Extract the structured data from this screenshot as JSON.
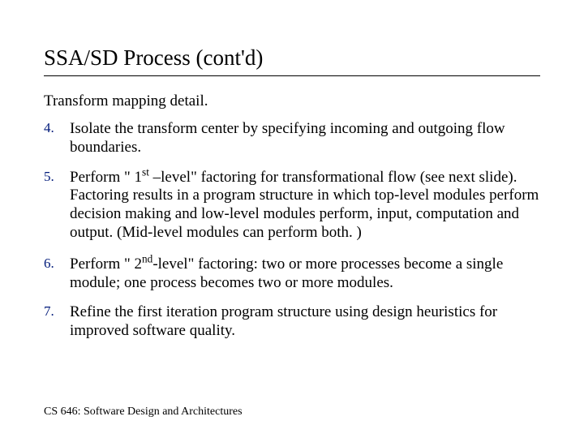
{
  "title": "SSA/SD Process (cont'd)",
  "subtitle": "Transform mapping detail.",
  "items": [
    {
      "number": "4.",
      "text_before": "Isolate the transform center by specifying incoming and outgoing flow boundaries.",
      "has_sup": false
    },
    {
      "number": "5.",
      "text_before": "Perform \" 1",
      "sup": "st",
      "text_after": " –level\" factoring for transformational flow (see next slide). Factoring results in a program structure in which top-level modules perform decision making and low-level modules perform, input, computation and output. (Mid-level modules can perform both. )",
      "has_sup": true
    },
    {
      "number": "6.",
      "text_before": "Perform \" 2",
      "sup": "nd",
      "text_after": "-level\" factoring: two or more processes become a single module; one process becomes two or more modules.",
      "has_sup": true
    },
    {
      "number": "7.",
      "text_before": "Refine the first iteration program structure using design heuristics for improved software quality.",
      "has_sup": false
    }
  ],
  "footer": "CS 646: Software Design and Architectures"
}
